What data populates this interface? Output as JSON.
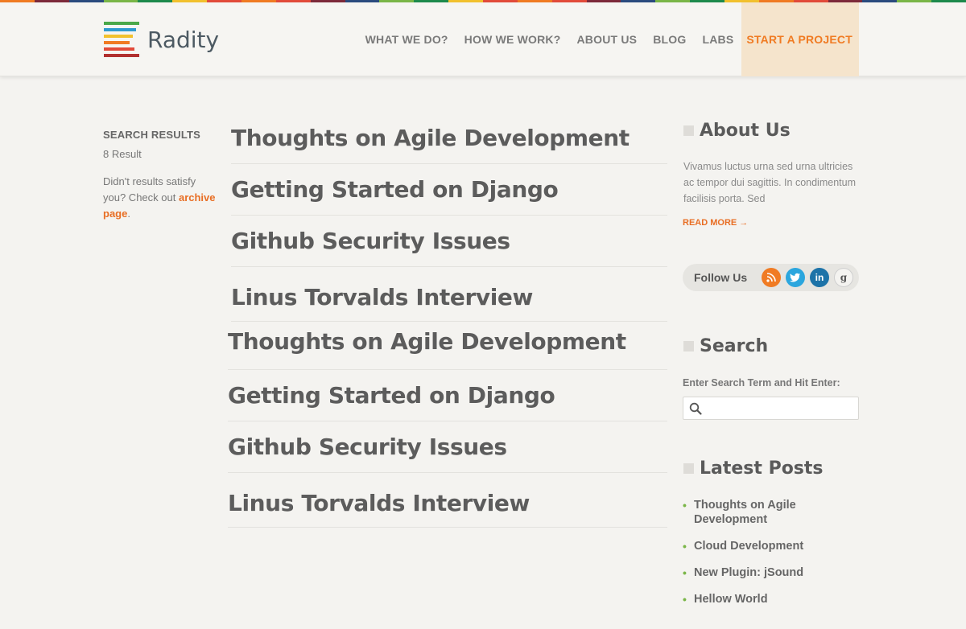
{
  "colors": {
    "strip": [
      "#f07b23",
      "#7d2a3b",
      "#2b4b7e",
      "#7ab648",
      "#1e8a4c",
      "#f2c12e",
      "#e24b3a",
      "#f07b23",
      "#e24b3a",
      "#7d2a3b",
      "#2b4b7e",
      "#7ab648",
      "#1e8a4c",
      "#f2c12e",
      "#e24b3a",
      "#f07b23",
      "#e24b3a",
      "#7d2a3b",
      "#2b4b7e",
      "#7ab648",
      "#1e8a4c",
      "#f2c12e",
      "#f07b23",
      "#e24b3a",
      "#7d2a3b",
      "#2b4b7e",
      "#7ab648",
      "#1e8a4c"
    ],
    "logo_bars": [
      "#4aa84a",
      "#2e9ad0",
      "#f2c12e",
      "#f07b23",
      "#e24b3a",
      "#b1302f"
    ],
    "accent": "#e86e24"
  },
  "brand": {
    "name": "Radity"
  },
  "nav": {
    "items": [
      "WHAT WE DO?",
      "HOW WE WORK?",
      "ABOUT US",
      "BLOG",
      "LABS"
    ],
    "cta": "START A PROJECT"
  },
  "search_results": {
    "title": "SEARCH RESULTS",
    "count": "8 Result",
    "note_prefix": "Didn't results satisfy you? Check out",
    "note_link": "archive page",
    "note_suffix": "."
  },
  "results": [
    "Thoughts on Agile Development",
    "Getting Started on Django",
    "Github Security Issues",
    "Linus Torvalds Interview",
    "Thoughts on Agile Development",
    "Getting Started on Django",
    "Github Security Issues",
    "Linus Torvalds Interview"
  ],
  "sidebar": {
    "about": {
      "title": "About Us",
      "text": "Vivamus luctus urna sed urna ultricies ac tempor dui sagittis. In condimentum facilisis porta. Sed",
      "read_more": "READ MORE →"
    },
    "follow": {
      "label": "Follow Us",
      "icons": [
        "rss-icon",
        "twitter-icon",
        "linkedin-icon",
        "gowalla-icon"
      ]
    },
    "search": {
      "title": "Search",
      "label": "Enter Search Term and Hit Enter:",
      "value": ""
    },
    "latest": {
      "title": "Latest Posts",
      "posts": [
        "Thoughts on Agile Development",
        "Cloud Development",
        "New Plugin: jSound",
        "Hellow World"
      ]
    }
  }
}
